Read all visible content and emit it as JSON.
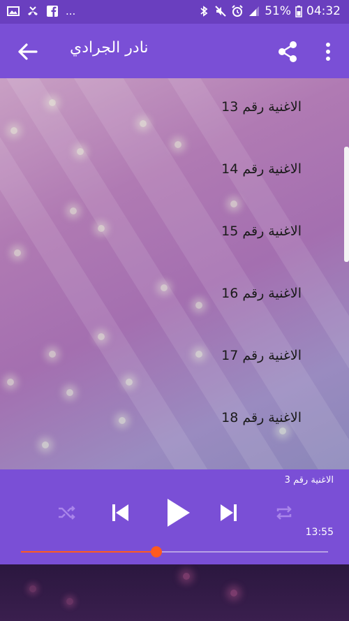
{
  "status_bar": {
    "left_more": "...",
    "battery": "51%",
    "time": "04:32"
  },
  "app_bar": {
    "title": "نادر الجرادي"
  },
  "songs": [
    {
      "label": "الاغنية رقم 13"
    },
    {
      "label": "الاغنية رقم 14"
    },
    {
      "label": "الاغنية رقم 15"
    },
    {
      "label": "الاغنية رقم 16"
    },
    {
      "label": "الاغنية رقم 17"
    },
    {
      "label": "الاغنية رقم 18"
    }
  ],
  "player": {
    "now_playing": "الاغنية رقم 3",
    "time": "13:55",
    "progress": 0.44
  },
  "colors": {
    "accent": "#7a4fd6",
    "seek": "#ff5a1f"
  }
}
